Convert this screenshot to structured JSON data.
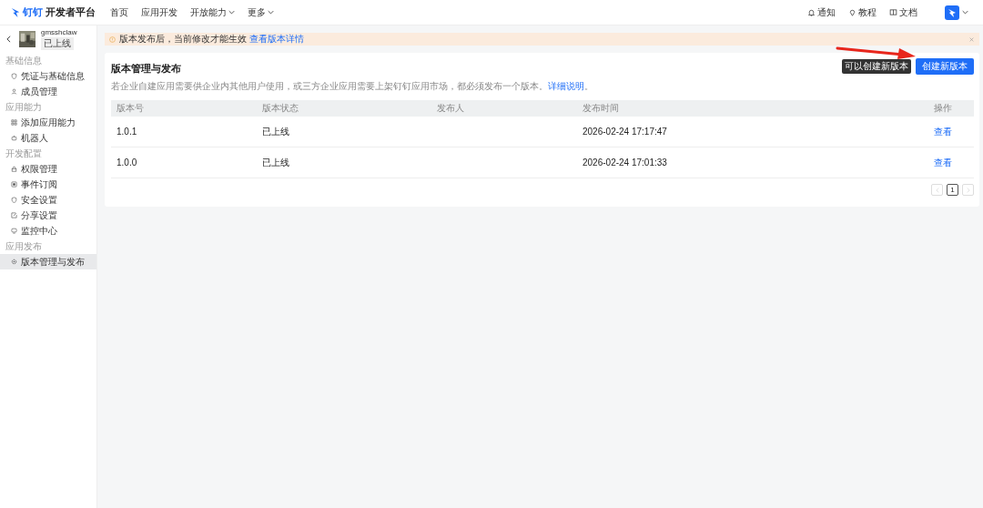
{
  "topbar": {
    "brand": "开发者平台",
    "logo_text": "钉钉",
    "nav": [
      {
        "label": "首页",
        "dropdown": false
      },
      {
        "label": "应用开发",
        "dropdown": false
      },
      {
        "label": "开放能力",
        "dropdown": true
      },
      {
        "label": "更多",
        "dropdown": true
      }
    ],
    "links": [
      {
        "label": "通知"
      },
      {
        "label": "教程"
      },
      {
        "label": "文档"
      }
    ]
  },
  "sidebar": {
    "app": {
      "name": "gmsshclaw",
      "status": "已上线"
    },
    "groups": [
      {
        "title": "基础信息",
        "items": [
          {
            "label": "凭证与基础信息",
            "selected": false
          },
          {
            "label": "成员管理",
            "selected": false
          }
        ]
      },
      {
        "title": "应用能力",
        "items": [
          {
            "label": "添加应用能力",
            "selected": false
          },
          {
            "label": "机器人",
            "selected": false
          }
        ]
      },
      {
        "title": "开发配置",
        "items": [
          {
            "label": "权限管理",
            "selected": false
          },
          {
            "label": "事件订阅",
            "selected": false
          },
          {
            "label": "安全设置",
            "selected": false
          },
          {
            "label": "分享设置",
            "selected": false
          },
          {
            "label": "监控中心",
            "selected": false
          }
        ]
      },
      {
        "title": "应用发布",
        "items": [
          {
            "label": "版本管理与发布",
            "selected": true
          }
        ]
      }
    ]
  },
  "banner": {
    "text": "版本发布后，当前修改才能生效",
    "link": "查看版本详情"
  },
  "page": {
    "title": "版本管理与发布",
    "description": "若企业自建应用需要供企业内其他用户使用，或三方企业应用需要上架钉钉应用市场，都必须发布一个版本。",
    "description_link": "详细说明",
    "description_end": "。",
    "create_button": "创建新版本",
    "tooltip": "可以创建新版本"
  },
  "table": {
    "columns": [
      "版本号",
      "版本状态",
      "发布人",
      "发布时间",
      "操作"
    ],
    "rows": [
      {
        "version": "1.0.1",
        "status": "已上线",
        "time": "2026-02-24 17:17:47",
        "action": "查看"
      },
      {
        "version": "1.0.0",
        "status": "已上线",
        "time": "2026-02-24 17:01:33",
        "action": "查看"
      }
    ]
  },
  "pagination": {
    "pages": [
      {
        "label": "1",
        "selected": true
      }
    ]
  }
}
